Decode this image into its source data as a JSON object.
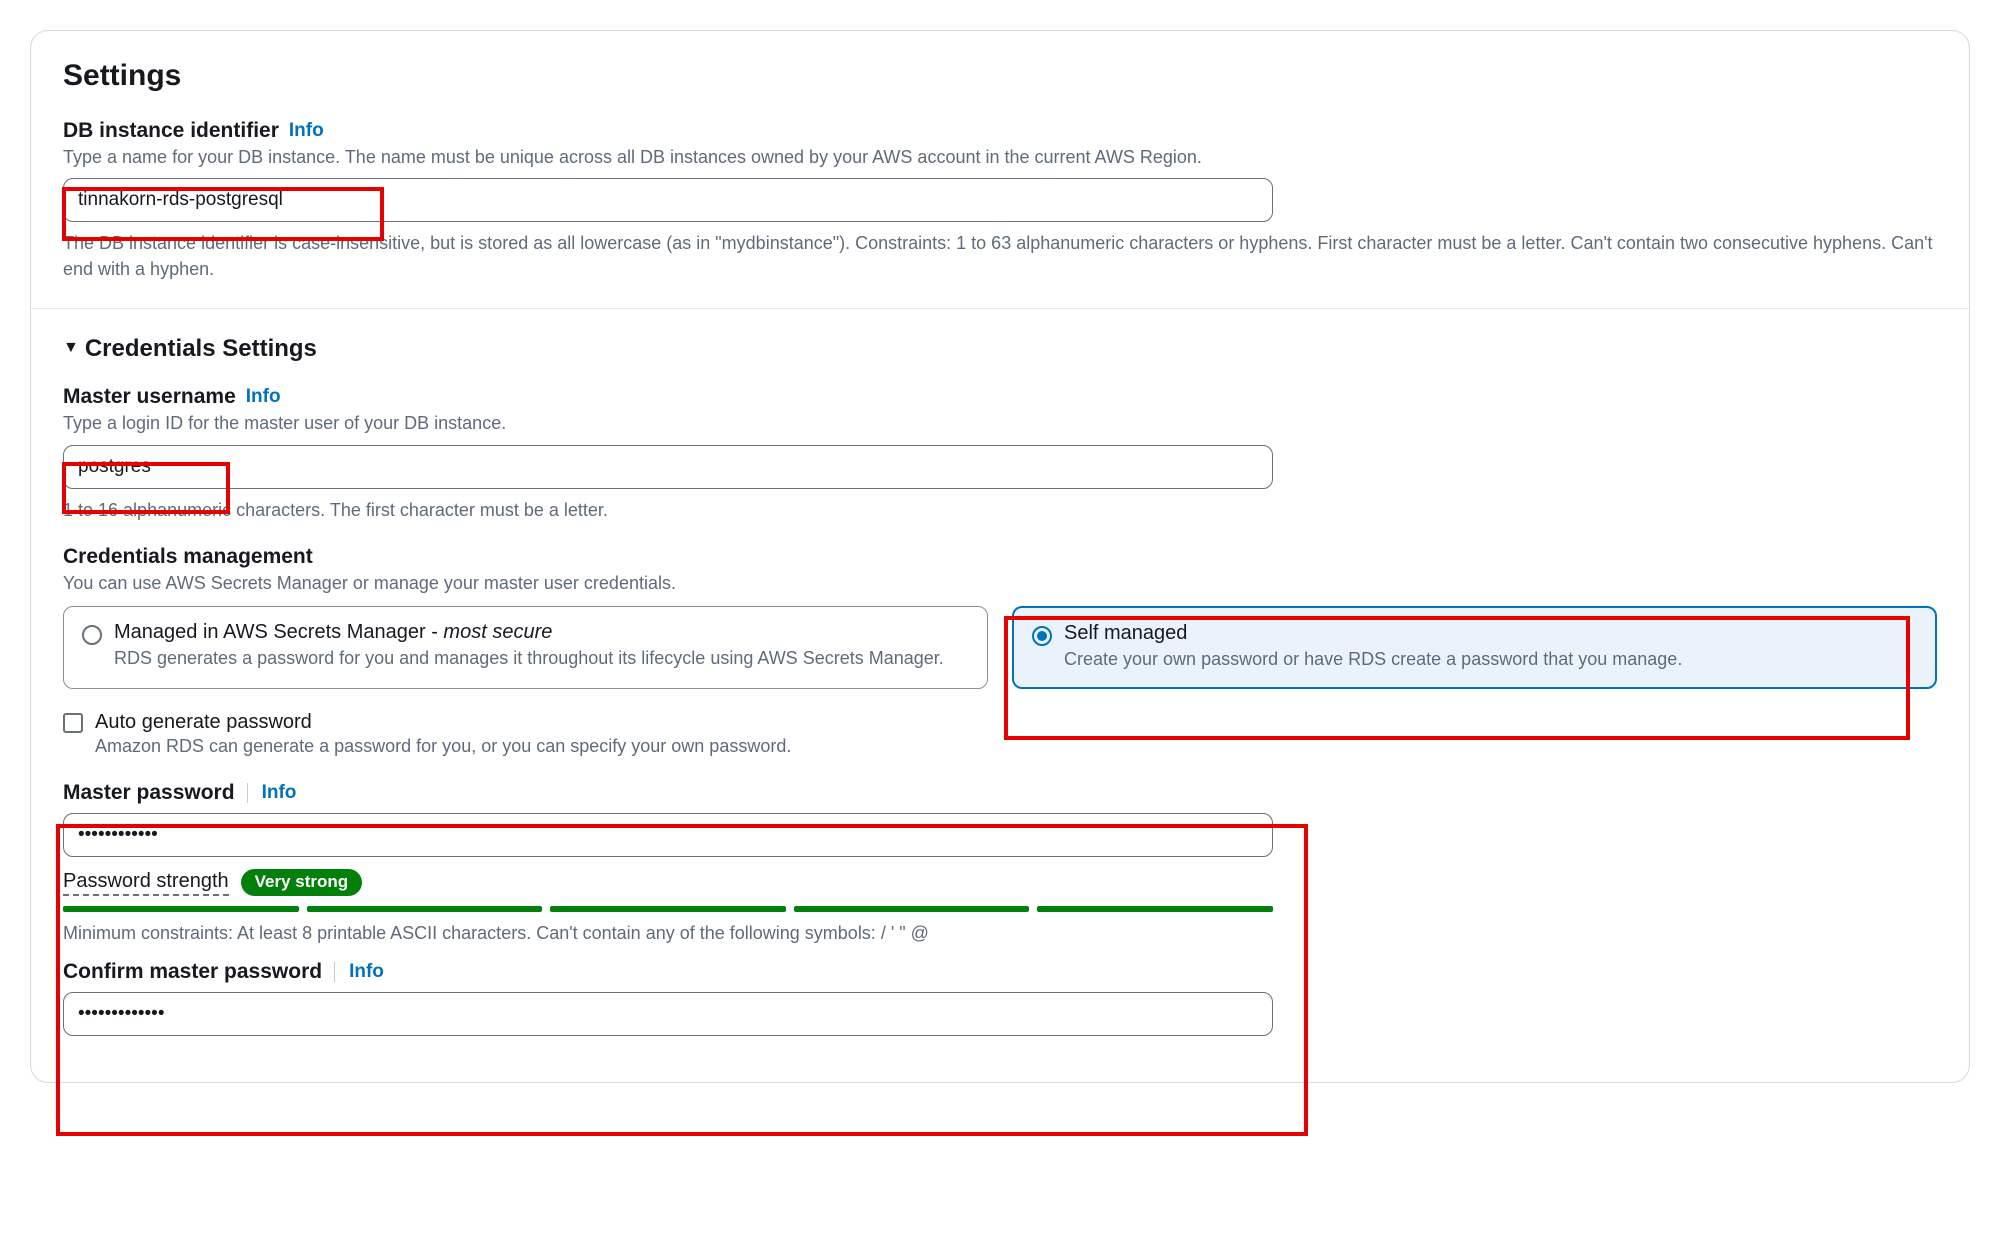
{
  "settings": {
    "title": "Settings",
    "db_identifier": {
      "label": "DB instance identifier",
      "info": "Info",
      "description": "Type a name for your DB instance. The name must be unique across all DB instances owned by your AWS account in the current AWS Region.",
      "value": "tinnakorn-rds-postgresql",
      "constraints": "The DB instance identifier is case-insensitive, but is stored as all lowercase (as in \"mydbinstance\"). Constraints: 1 to 63 alphanumeric characters or hyphens. First character must be a letter. Can't contain two consecutive hyphens. Can't end with a hyphen."
    }
  },
  "credentials": {
    "section_title": "Credentials Settings",
    "master_username": {
      "label": "Master username",
      "info": "Info",
      "description": "Type a login ID for the master user of your DB instance.",
      "value": "postgres",
      "constraints": "1 to 16 alphanumeric characters. The first character must be a letter."
    },
    "management": {
      "label": "Credentials management",
      "description": "You can use AWS Secrets Manager or manage your master user credentials.",
      "options": [
        {
          "title_main": "Managed in AWS Secrets Manager - ",
          "title_italic": "most secure",
          "desc": "RDS generates a password for you and manages it throughout its lifecycle using AWS Secrets Manager.",
          "selected": false
        },
        {
          "title_main": "Self managed",
          "title_italic": "",
          "desc": "Create your own password or have RDS create a password that you manage.",
          "selected": true
        }
      ]
    },
    "auto_generate": {
      "label": "Auto generate password",
      "desc": "Amazon RDS can generate a password for you, or you can specify your own password.",
      "checked": false
    },
    "master_password": {
      "label": "Master password",
      "info": "Info",
      "value": "••••••••••••",
      "strength_label": "Password strength",
      "strength_badge": "Very strong",
      "constraints": "Minimum constraints: At least 8 printable ASCII characters. Can't contain any of the following symbols: / ' \" @"
    },
    "confirm_password": {
      "label": "Confirm master password",
      "info": "Info",
      "value": "•••••••••••••"
    }
  }
}
